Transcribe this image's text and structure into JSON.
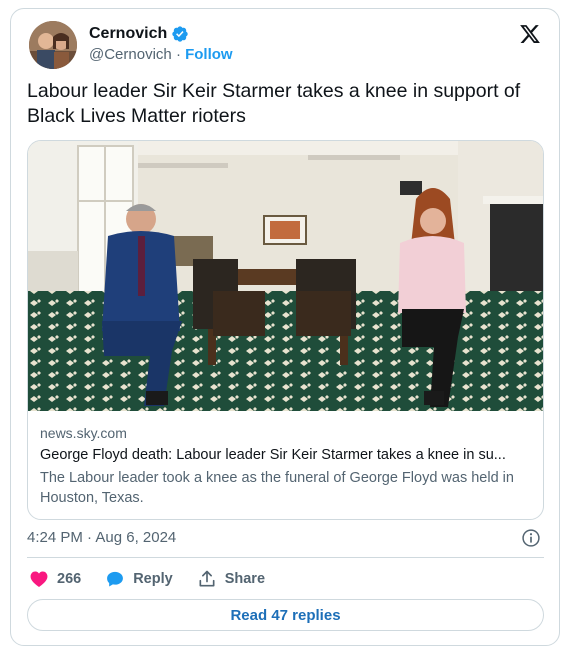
{
  "tweet": {
    "author": {
      "display_name": "Cernovich",
      "handle": "@Cernovich",
      "separator": "·",
      "follow_label": "Follow",
      "verified_color": "#1d9bf0"
    },
    "platform_icon": "x-logo-icon",
    "text": "Labour leader Sir Keir Starmer takes a knee in support of Black Lives Matter rioters",
    "link_card": {
      "domain": "news.sky.com",
      "title": "George Floyd death: Labour leader Sir Keir Starmer takes a knee in su...",
      "description": "The Labour leader took a knee as the funeral of George Floyd was held in Houston, Texas."
    },
    "timestamp": "4:24 PM · Aug 6, 2024",
    "info_icon": "info-icon",
    "actions": {
      "like_count": "266",
      "reply_label": "Reply",
      "share_label": "Share",
      "like_color": "#f91880",
      "reply_color": "#1d9bf0"
    },
    "read_replies_label": "Read 47 replies"
  }
}
